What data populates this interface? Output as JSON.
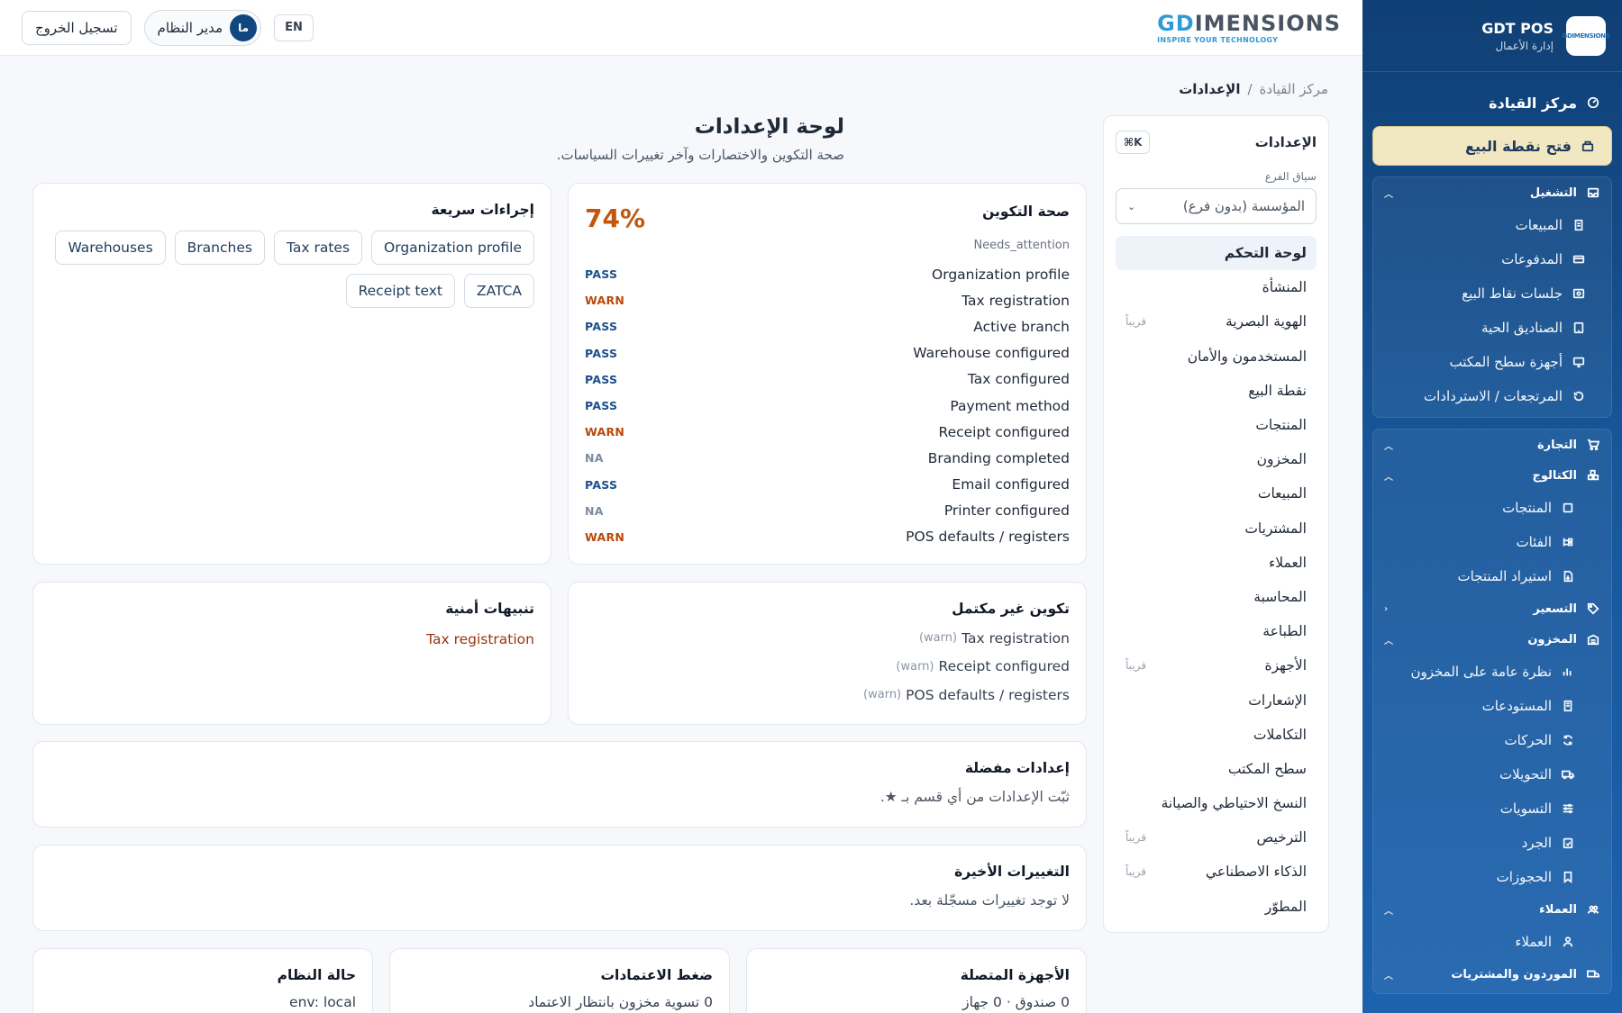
{
  "brand": {
    "name": "GDT POS",
    "subtitle": "إدارة الأعمال",
    "logo_text": "GDIMENSIONS"
  },
  "topbar": {
    "logo_word_accent": "GD",
    "logo_word_rest": "IMENSIONS",
    "logo_tagline": "INSPIRE YOUR TECHNOLOGY",
    "logout_label": "تسجيل الخروج",
    "user_name": "مدير النظام",
    "user_initials": "ما",
    "lang_label": "EN"
  },
  "sidebar": {
    "command_center": "مركز القيادة",
    "open_pos": "فتح نقطة البيع",
    "operations": {
      "title": "التشغيل",
      "items": [
        "المبيعات",
        "المدفوعات",
        "جلسات نقاط البيع",
        "الصناديق الحية",
        "أجهزة سطح المكتب",
        "المرتجعات / الاستردادات"
      ]
    },
    "commerce": {
      "title": "التجارة",
      "catalog": {
        "title": "الكتالوج",
        "items": [
          "المنتجات",
          "الفئات",
          "استيراد المنتجات"
        ]
      },
      "pricing": {
        "title": "التسعير"
      },
      "inventory": {
        "title": "المخزون",
        "items": [
          "نظرة عامة على المخزون",
          "المستودعات",
          "الحركات",
          "التحويلات",
          "التسويات",
          "الجرد",
          "الحجوزات"
        ]
      },
      "customers": {
        "title": "العملاء",
        "items": [
          "العملاء"
        ]
      },
      "suppliers": {
        "title": "الموردون والمشتريات"
      }
    }
  },
  "breadcrumb": {
    "root": "مركز القيادة",
    "sep": "/",
    "current": "الإعدادات"
  },
  "settings_nav": {
    "title": "الإعدادات",
    "shortcut": "⌘K",
    "branch_label": "سياق الفرع",
    "branch_value": "المؤسسة (بدون فرع)",
    "soon_label": "قريباً",
    "items": [
      {
        "label": "لوحة التحكم",
        "soon": ""
      },
      {
        "label": "المنشأة",
        "soon": ""
      },
      {
        "label": "الهوية البصرية",
        "soon": "قريباً"
      },
      {
        "label": "المستخدمون والأمان",
        "soon": ""
      },
      {
        "label": "نقطة البيع",
        "soon": ""
      },
      {
        "label": "المنتجات",
        "soon": ""
      },
      {
        "label": "المخزون",
        "soon": ""
      },
      {
        "label": "المبيعات",
        "soon": ""
      },
      {
        "label": "المشتريات",
        "soon": ""
      },
      {
        "label": "العملاء",
        "soon": ""
      },
      {
        "label": "المحاسبة",
        "soon": ""
      },
      {
        "label": "الطباعة",
        "soon": ""
      },
      {
        "label": "الأجهزة",
        "soon": "قريباً"
      },
      {
        "label": "الإشعارات",
        "soon": ""
      },
      {
        "label": "التكاملات",
        "soon": ""
      },
      {
        "label": "سطح المكتب",
        "soon": ""
      },
      {
        "label": "النسخ الاحتياطي والصيانة",
        "soon": ""
      },
      {
        "label": "الترخيص",
        "soon": "قريباً"
      },
      {
        "label": "الذكاء الاصطناعي",
        "soon": "قريباً"
      },
      {
        "label": "المطوّر",
        "soon": ""
      }
    ]
  },
  "page": {
    "title": "لوحة الإعدادات",
    "subtitle": "صحة التكوين والاختصارات وآخر تغييرات السياسات."
  },
  "health": {
    "title": "صحة التكوين",
    "percent": "74%",
    "status": "Needs_attention",
    "checks": [
      {
        "label": "Organization profile",
        "status": "PASS"
      },
      {
        "label": "Tax registration",
        "status": "WARN"
      },
      {
        "label": "Active branch",
        "status": "PASS"
      },
      {
        "label": "Warehouse configured",
        "status": "PASS"
      },
      {
        "label": "Tax configured",
        "status": "PASS"
      },
      {
        "label": "Payment method",
        "status": "PASS"
      },
      {
        "label": "Receipt configured",
        "status": "WARN"
      },
      {
        "label": "Branding completed",
        "status": "NA"
      },
      {
        "label": "Email configured",
        "status": "PASS"
      },
      {
        "label": "Printer configured",
        "status": "NA"
      },
      {
        "label": "POS defaults / registers",
        "status": "WARN"
      }
    ]
  },
  "quick_actions": {
    "title": "إجراءات سريعة",
    "items": [
      "Organization profile",
      "Tax rates",
      "Branches",
      "Warehouses",
      "ZATCA",
      "Receipt text"
    ]
  },
  "incomplete": {
    "title": "تكوين غير مكتمل",
    "items": [
      {
        "label": "Tax registration",
        "tag": "(warn)"
      },
      {
        "label": "Receipt configured",
        "tag": "(warn)"
      },
      {
        "label": "POS defaults / registers",
        "tag": "(warn)"
      }
    ]
  },
  "security": {
    "title": "تنبيهات أمنية",
    "items": [
      "Tax registration"
    ]
  },
  "favorites": {
    "title": "إعدادات مفضلة",
    "text": "ثبّت الإعدادات من أي قسم بـ ★."
  },
  "recent": {
    "title": "التغييرات الأخيرة",
    "text": "لا توجد تغييرات مسجّلة بعد."
  },
  "devices": {
    "title": "الأجهزة المتصلة",
    "text": "0 صندوق · 0 جهاز"
  },
  "approvals": {
    "title": "ضغط الاعتمادات",
    "text": "0 تسوية مخزون بانتظار الاعتماد"
  },
  "system_status": {
    "title": "حالة النظام",
    "text": "env: local"
  },
  "colors": {
    "sidebar": "#0f3f74",
    "accent": "#12467f",
    "warn": "#b9480a",
    "pass": "#1d4f8c",
    "percent": "#c2570c"
  }
}
